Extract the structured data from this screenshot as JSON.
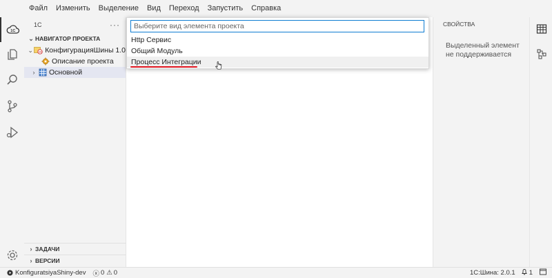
{
  "menu": [
    "Файл",
    "Изменить",
    "Выделение",
    "Вид",
    "Переход",
    "Запустить",
    "Справка"
  ],
  "activity_icons": [
    "cloud-1c-icon",
    "files-icon",
    "search-icon",
    "source-control-icon",
    "run-debug-icon",
    "settings-gear-icon"
  ],
  "sidebar": {
    "title": "1С",
    "more": "···",
    "navigator_title": "НАВИГАТОР ПРОЕКТА",
    "tree": [
      {
        "label": "КонфигурацияШины 1.0",
        "expanded": true
      },
      {
        "label": "Описание проекта"
      },
      {
        "label": "Основной",
        "collapsed": true
      }
    ],
    "tasks_title": "ЗАДАЧИ",
    "versions_title": "ВЕРСИИ"
  },
  "quick_pick": {
    "placeholder": "Выберите вид элемента проекта",
    "items": [
      "Http Сервис",
      "Общий Модуль",
      "Процесс Интеграции"
    ],
    "highlighted_index": 2
  },
  "properties": {
    "title": "СВОЙСТВА",
    "message": "Выделенный элемент не поддерживается"
  },
  "statusbar": {
    "project": "KonfiguratsiyaShiny-dev",
    "errors": "0",
    "warnings": "0",
    "version": "1С:Шина: 2.0.1",
    "notifications": "1"
  },
  "colors": {
    "accent_red": "#e0141e",
    "focus_blue": "#0c7bd1",
    "chrome": "#f3f3f3"
  }
}
